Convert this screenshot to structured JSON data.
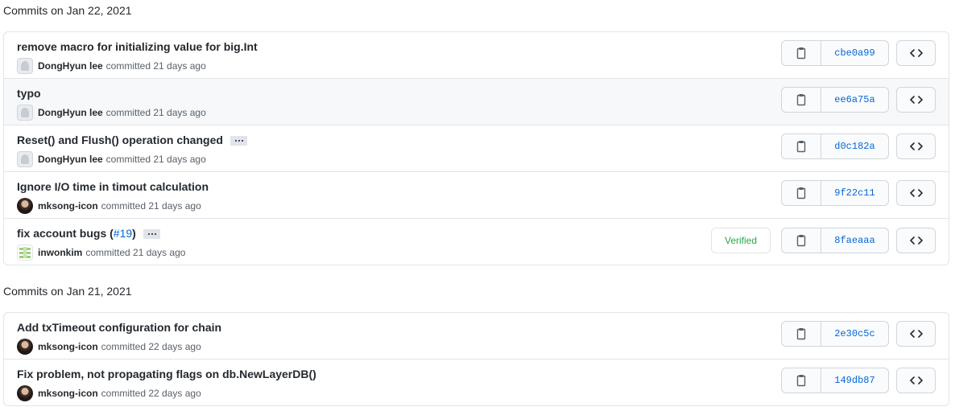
{
  "groups": [
    {
      "title": "Commits on Jan 22, 2021",
      "commits": [
        {
          "message": "remove macro for initializing value for big.Int",
          "author": "DongHyun lee",
          "when": "committed 21 days ago",
          "sha": "cbe0a99",
          "avatar": "default-avatar",
          "has_ellipsis": false
        },
        {
          "message": "typo",
          "author": "DongHyun lee",
          "when": "committed 21 days ago",
          "sha": "ee6a75a",
          "avatar": "default-avatar",
          "has_ellipsis": false,
          "highlighted": true
        },
        {
          "message": "Reset() and Flush() operation changed",
          "author": "DongHyun lee",
          "when": "committed 21 days ago",
          "sha": "d0c182a",
          "avatar": "default-avatar",
          "has_ellipsis": true
        },
        {
          "message": "Ignore I/O time in timout calculation",
          "author": "mksong-icon",
          "when": "committed 21 days ago",
          "sha": "9f22c11",
          "avatar": "photo-avatar",
          "has_ellipsis": false
        },
        {
          "message": "fix account bugs (",
          "issue_ref": "#19",
          "message_tail": ")",
          "author": "inwonkim",
          "when": "committed 21 days ago",
          "sha": "8faeaaa",
          "avatar": "identicon-avatar",
          "has_ellipsis": true,
          "verified": "Verified"
        }
      ]
    },
    {
      "title": "Commits on Jan 21, 2021",
      "commits": [
        {
          "message": "Add txTimeout configuration for chain",
          "author": "mksong-icon",
          "when": "committed 22 days ago",
          "sha": "2e30c5c",
          "avatar": "photo-avatar",
          "has_ellipsis": false
        },
        {
          "message": "Fix problem, not propagating flags on db.NewLayerDB()",
          "author": "mksong-icon",
          "when": "committed 22 days ago",
          "sha": "149db87",
          "avatar": "photo-avatar",
          "has_ellipsis": false
        }
      ]
    }
  ],
  "icons": {
    "copy": "clipboard-icon",
    "browse": "code-icon"
  },
  "colors": {
    "link": "#0366d6",
    "verified": "#28a745",
    "border": "#e1e4e8"
  }
}
